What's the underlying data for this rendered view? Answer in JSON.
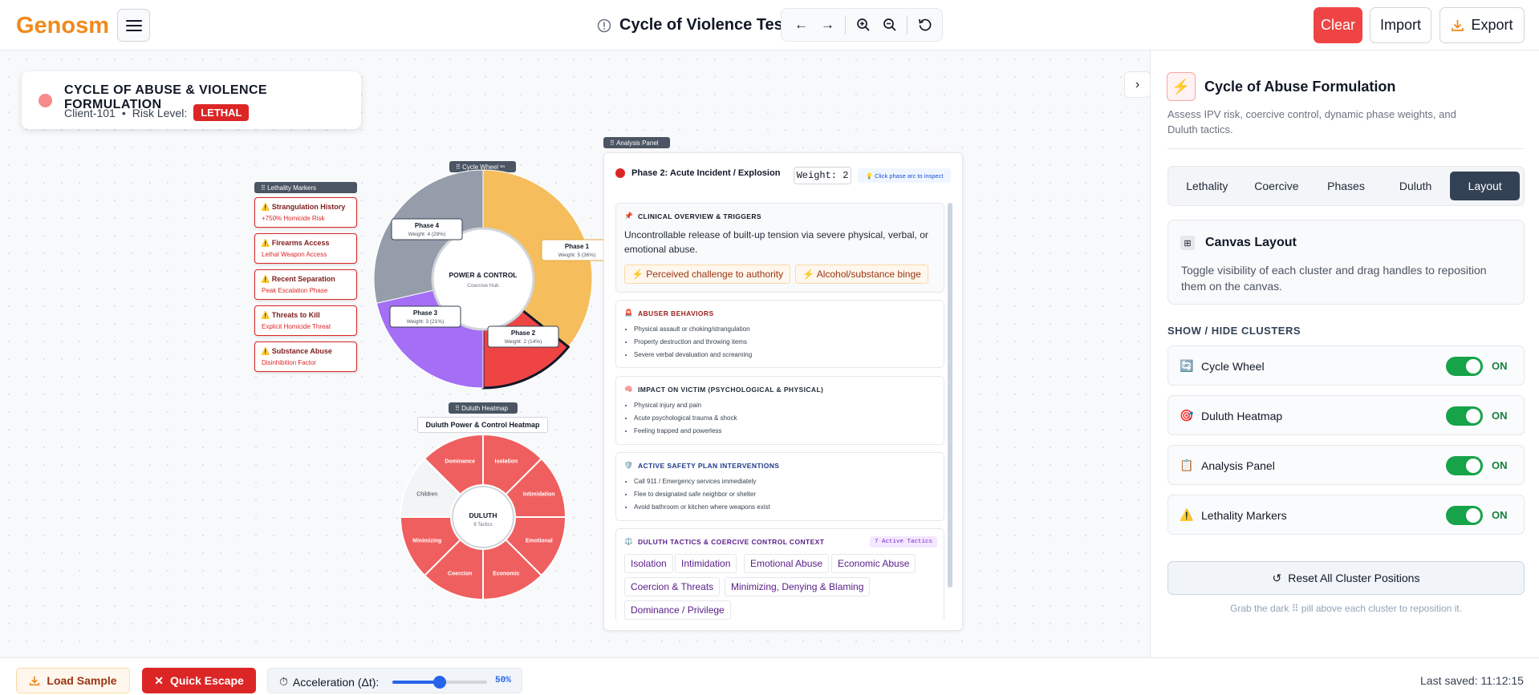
{
  "app": {
    "logo": "Genosm",
    "title": "Cycle of Violence Test",
    "clear_label": "Clear",
    "import_label": "Import",
    "export_label": "Export",
    "brand_color": "#f08a1c"
  },
  "client": {
    "title": "CYCLE OF ABUSE & VIOLENCE FORMULATION",
    "id": "Client-101",
    "separator": "•",
    "risk_label": "Risk Level:",
    "risk_value": "LETHAL"
  },
  "clusters": {
    "lethality_pill": "⠿ Lethality Markers",
    "wheel_pill": "⠿ Cycle Wheel ᵒⁿ",
    "heatmap_pill": "⠿ Duluth Heatmap",
    "analysis_pill": "⠿ Analysis Panel"
  },
  "lethality_markers": [
    {
      "title": "Strangulation History",
      "sub": "+750% Homicide Risk"
    },
    {
      "title": "Firearms Access",
      "sub": "Lethal Weapon Access"
    },
    {
      "title": "Recent Separation",
      "sub": "Peak Escalation Phase"
    },
    {
      "title": "Threats to Kill",
      "sub": "Explicit Homicide Threat"
    },
    {
      "title": "Substance Abuse",
      "sub": "Disinhibition Factor"
    }
  ],
  "wheel": {
    "center_title": "POWER & CONTROL",
    "center_sub": "Coercive Hub",
    "phases": [
      {
        "name": "Phase 1",
        "weight": "Weight: 5 (36%)",
        "value": 5,
        "color": "#f5bd5c"
      },
      {
        "name": "Phase 2",
        "weight": "Weight: 2 (14%)",
        "value": 2,
        "color": "#ef4444"
      },
      {
        "name": "Phase 3",
        "weight": "Weight: 3 (21%)",
        "value": 3,
        "color": "#a46ef5"
      },
      {
        "name": "Phase 4",
        "weight": "Weight: 4 (29%)",
        "value": 4,
        "color": "#959dab"
      }
    ]
  },
  "heatmap": {
    "title": "Duluth Power & Control Heatmap",
    "center_title": "DULUTH",
    "center_sub": "8 Tactics",
    "tactics": [
      {
        "name": "Isolation",
        "active": true
      },
      {
        "name": "Intimidation",
        "active": true
      },
      {
        "name": "Emotional",
        "active": true
      },
      {
        "name": "Economic",
        "active": true
      },
      {
        "name": "Coercion",
        "active": true
      },
      {
        "name": "Minimizing",
        "active": true
      },
      {
        "name": "Children",
        "active": false
      },
      {
        "name": "Dominance",
        "active": true
      }
    ]
  },
  "analysis": {
    "phase_title": "Phase 2: Acute Incident / Explosion",
    "weight": "Weight: 2",
    "hint": "💡 Click phase arc to inspect",
    "overview_title": "CLINICAL OVERVIEW & TRIGGERS",
    "overview_text": "Uncontrollable release of built-up tension via severe physical, verbal, or emotional abuse.",
    "triggers": [
      "Perceived challenge to authority",
      "Alcohol/substance binge"
    ],
    "abuser_title": "ABUSER BEHAVIORS",
    "abuser_items": [
      "Physical assault or choking/strangulation",
      "Property destruction and throwing items",
      "Severe verbal devaluation and screaming"
    ],
    "impact_title": "IMPACT ON VICTIM (PSYCHOLOGICAL & PHYSICAL)",
    "impact_items": [
      "Physical injury and pain",
      "Acute psychological trauma & shock",
      "Feeling trapped and powerless"
    ],
    "safety_title": "ACTIVE SAFETY PLAN INTERVENTIONS",
    "safety_items": [
      "Call 911 / Emergency services immediately",
      "Flee to designated safe neighbor or shelter",
      "Avoid bathroom or kitchen where weapons exist"
    ],
    "duluth_title": "DULUTH TACTICS & COERCIVE CONTROL CONTEXT",
    "duluth_badge": "7 Active Tactics",
    "duluth_tags": [
      "Isolation",
      "Intimidation",
      "Emotional Abuse",
      "Economic Abuse",
      "Coercion & Threats",
      "Minimizing, Denying & Blaming",
      "Dominance / Privilege"
    ]
  },
  "sidebar": {
    "title": "Cycle of Abuse Formulation",
    "subtitle": "Assess IPV risk, coercive control, dynamic phase weights, and Duluth tactics.",
    "tabs": [
      "Lethality",
      "Coercive",
      "Phases",
      "Duluth",
      "Layout"
    ],
    "active_tab": "Layout",
    "layout_title": "Canvas Layout",
    "layout_desc": "Toggle visibility of each cluster and drag handles to reposition them on the canvas.",
    "show_hide_label": "SHOW / HIDE CLUSTERS",
    "clusters": [
      {
        "label": "Cycle Wheel",
        "icon": "🔄",
        "state": "ON"
      },
      {
        "label": "Duluth Heatmap",
        "icon": "🎯",
        "state": "ON"
      },
      {
        "label": "Analysis Panel",
        "icon": "📋",
        "state": "ON"
      },
      {
        "label": "Lethality Markers",
        "icon": "⚠️",
        "state": "ON"
      }
    ],
    "reset_label": "Reset All Cluster Positions",
    "grab_hint": "Grab the dark ⠿ pill above each cluster to reposition it."
  },
  "footer": {
    "load_sample": "Load Sample",
    "quick_escape": "Quick Escape",
    "acceleration_label": "Acceleration (Δt):",
    "acceleration_value": "50%",
    "acceleration_fraction": 0.5,
    "last_saved": "Last saved: 11:12:15"
  }
}
